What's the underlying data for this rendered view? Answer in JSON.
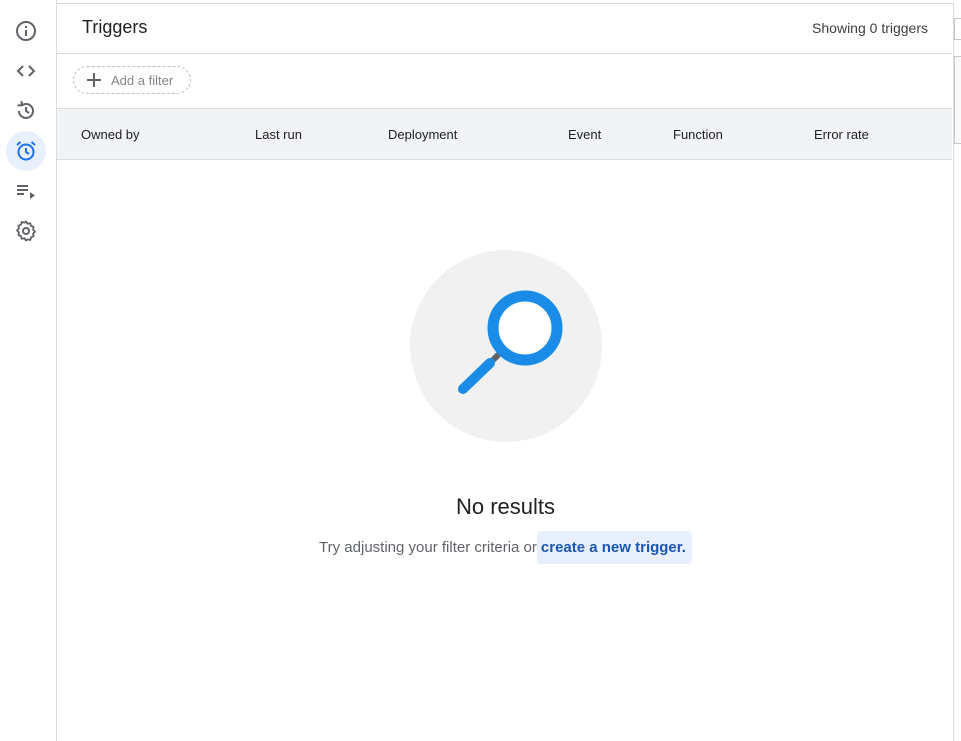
{
  "rail": {
    "items": [
      {
        "icon": "info-icon"
      },
      {
        "icon": "code-icon"
      },
      {
        "icon": "history-icon"
      },
      {
        "icon": "alarm-clock-icon",
        "active": true
      },
      {
        "icon": "playlist-play-icon"
      },
      {
        "icon": "gear-icon"
      }
    ],
    "active_color": "#1a73e8",
    "active_bg": "#e8f0fe"
  },
  "header": {
    "title": "Triggers",
    "count_text": "Showing 0 triggers"
  },
  "filter": {
    "add_label": "Add a filter"
  },
  "table": {
    "columns": [
      "Owned by",
      "Last run",
      "Deployment",
      "Event",
      "Function",
      "Error rate"
    ]
  },
  "empty_state": {
    "icon": "magnifier-icon",
    "heading": "No results",
    "hint": "Try adjusting your filter criteria or",
    "link": "create a new trigger."
  },
  "colors": {
    "accent": "#1a73e8",
    "magnifier": "#1a8ce8",
    "link": "#1a56b4"
  }
}
